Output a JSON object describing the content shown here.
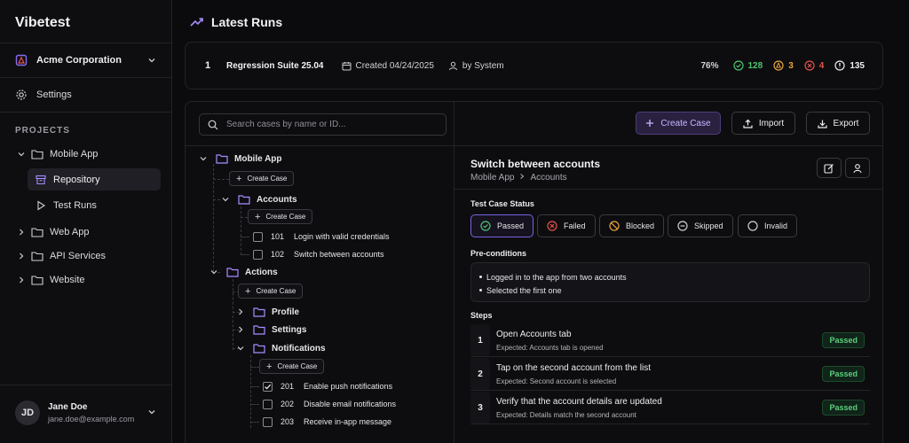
{
  "app": {
    "brand": "Vibetest"
  },
  "sidebar": {
    "org": "Acme Corporation",
    "settings": "Settings",
    "projects_title": "PROJECTS",
    "projects": [
      {
        "label": "Mobile App",
        "children": [
          {
            "label": "Repository",
            "icon": "archive-icon",
            "active": true
          },
          {
            "label": "Test Runs",
            "icon": "play-icon"
          }
        ]
      },
      {
        "label": "Web App"
      },
      {
        "label": "API Services"
      },
      {
        "label": "Website"
      }
    ],
    "user": {
      "initials": "JD",
      "name": "Jane Doe",
      "email": "jane.doe@example.com"
    }
  },
  "header": {
    "title": "Latest Runs"
  },
  "run": {
    "number": "1",
    "name": "Regression Suite 25.04",
    "created": "Created 04/24/2025",
    "by": "by System",
    "percent": "76%",
    "passed": "128",
    "warnings": "3",
    "failed": "4",
    "total": "135"
  },
  "toolbar": {
    "search_placeholder": "Search cases by name or ID...",
    "create_case": "Create Case",
    "import": "Import",
    "export": "Export"
  },
  "tree": {
    "root": "Mobile App",
    "create_case": "Create Case",
    "accounts": "Accounts",
    "case_101_id": "101",
    "case_101": "Login with valid credentials",
    "case_102_id": "102",
    "case_102": "Switch between accounts",
    "actions": "Actions",
    "profile": "Profile",
    "settings": "Settings",
    "notifications": "Notifications",
    "case_201_id": "201",
    "case_201": "Enable push notifications",
    "case_202_id": "202",
    "case_202": "Disable email notifications",
    "case_203_id": "203",
    "case_203": "Receive in-app message"
  },
  "detail": {
    "title": "Switch between accounts",
    "crumb_project": "Mobile App",
    "crumb_folder": "Accounts",
    "status_label": "Test Case Status",
    "statuses": [
      "Passed",
      "Failed",
      "Blocked",
      "Skipped",
      "Invalid"
    ],
    "selected_status": "Passed",
    "preconditions_label": "Pre-conditions",
    "preconditions": [
      "Logged in to the app from two accounts",
      "Selected the first one"
    ],
    "steps_label": "Steps",
    "steps": [
      {
        "n": "1",
        "title": "Open Accounts tab",
        "expected": "Expected: Accounts tab is opened",
        "status": "Passed"
      },
      {
        "n": "2",
        "title": "Tap on the second account from the list",
        "expected": "Expected: Second account is selected",
        "status": "Passed"
      },
      {
        "n": "3",
        "title": "Verify that the account details are updated",
        "expected": "Expected: Details match the second account",
        "status": "Passed"
      }
    ]
  },
  "colors": {
    "accent": "#8b6cf0",
    "success": "#4fc56f",
    "warning": "#e8a33c",
    "danger": "#e5534b",
    "background": "#0b0b0d"
  }
}
